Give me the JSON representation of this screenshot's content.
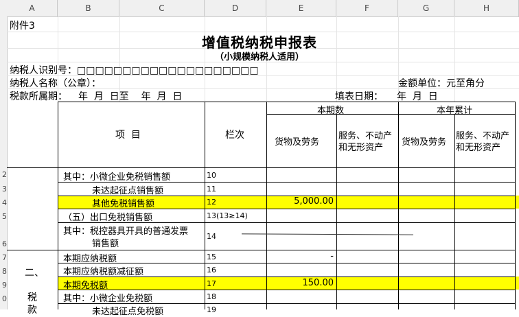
{
  "column_headers": [
    "A",
    "B",
    "C",
    "D",
    "E",
    "F",
    "G",
    "H"
  ],
  "row_headers": [
    "2",
    "3",
    "4",
    "5",
    "6",
    "7",
    "8",
    "9",
    "0"
  ],
  "title": "增值税纳税申报表",
  "subtitle": "（小规模纳税人适用）",
  "attachment": "附件3",
  "taxpayer_id_label": "纳税人识别号：□□□□□□□□□□□□□□□□□□□□",
  "taxpayer_name_label": "纳税人名称（公章）：",
  "amount_unit": "金额单位：元至角分",
  "tax_period_label": "税款所属期：",
  "tax_period_value": "年  月  日至    年  月  日",
  "fill_date_label": "填表日期：",
  "fill_date_value": "年  月  日",
  "header": {
    "item": "项  目",
    "col_no": "栏次",
    "current_period": "本期数",
    "year_total": "本年累计",
    "goods_services": "货物及劳务",
    "services_realestate_1": "服务、不动产",
    "services_realestate_2": "和无形资产"
  },
  "rows": [
    {
      "item": "其中：小微企业免税销售额",
      "no": "10",
      "e": "",
      "highlight": false
    },
    {
      "item": "未达起征点销售额",
      "no": "11",
      "e": "",
      "highlight": false
    },
    {
      "item": "其他免税销售额",
      "no": "12",
      "e": "5,000.00",
      "highlight": true
    },
    {
      "item": "（五）出口免税销售额",
      "no": "13(13≥14)",
      "e": "",
      "highlight": false
    },
    {
      "item_line1": "其中：税控器具开具的普通发票",
      "item_line2": "销售额",
      "no": "14",
      "e": "",
      "highlight": false
    },
    {
      "item": "本期应纳税额",
      "no": "15",
      "e": "-",
      "highlight": false
    },
    {
      "item": "本期应纳税额减征额",
      "no": "16",
      "e": "",
      "highlight": false
    },
    {
      "item": "本期免税额",
      "no": "17",
      "e": "150.00",
      "highlight": true
    },
    {
      "item": "其中：小微企业免税额",
      "no": "18",
      "e": "",
      "highlight": false
    },
    {
      "item": "未达起征点免税额",
      "no": "19",
      "e": "",
      "highlight": false
    }
  ],
  "section_label_1": "二、",
  "section_label_2": "税",
  "section_label_3": "款"
}
